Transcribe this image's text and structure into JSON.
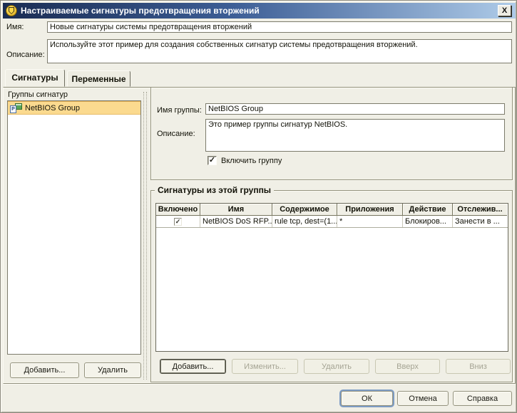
{
  "window": {
    "title": "Настраиваемые сигнатуры предотвращения вторжений"
  },
  "icons": {
    "close_glyph": "X",
    "check_glyph": "✓",
    "program_icon_letter": "P"
  },
  "colors": {
    "titlebar_gradient_left": "#1A2C52",
    "titlebar_gradient_right": "#AECBE8",
    "dialog_background": "#F0EFE6",
    "list_selection": "#FBDA8F",
    "ok_focus_ring": "#7D9CC4",
    "disabled_text": "#A5A494"
  },
  "fields": {
    "name_label": "Имя:",
    "name_value": "Новые сигнатуры системы предотвращения вторжений",
    "description_label": "Описание:",
    "description_value": "Используйте этот пример для создания собственных сигнатур системы предотвращения вторжений."
  },
  "tabs": [
    {
      "label": "Сигнатуры",
      "active": true
    },
    {
      "label": "Переменные",
      "active": false
    }
  ],
  "left_panel": {
    "groups_label": "Группы сигнатур",
    "items": [
      {
        "label": "NetBIOS Group",
        "selected": true
      }
    ],
    "add_button": "Добавить...",
    "delete_button": "Удалить"
  },
  "group_details": {
    "name_label": "Имя группы:",
    "name_value": "NetBIOS Group",
    "description_label": "Описание:",
    "description_value": "Это пример группы сигнатур NetBIOS.",
    "enable_label": "Включить группу",
    "enable_checked": true
  },
  "signatures": {
    "title": "Сигнатуры из этой группы",
    "table": {
      "columns": [
        "Включено",
        "Имя",
        "Содержимое",
        "Приложения",
        "Действие",
        "Отслежив..."
      ],
      "rows": [
        {
          "enabled": true,
          "name": "NetBIOS DoS RFP...",
          "content": "rule tcp, dest=(1...",
          "applications": "*",
          "action": "Блокиров...",
          "tracking": "Занести в ..."
        }
      ]
    },
    "buttons": [
      {
        "label": "Добавить...",
        "enabled": true,
        "focused": true
      },
      {
        "label": "Изменить...",
        "enabled": false
      },
      {
        "label": "Удалить",
        "enabled": false
      },
      {
        "label": "Вверх",
        "enabled": false
      },
      {
        "label": "Вниз",
        "enabled": false
      }
    ]
  },
  "footer": {
    "ok": "ОК",
    "cancel": "Отмена",
    "help": "Справка"
  }
}
